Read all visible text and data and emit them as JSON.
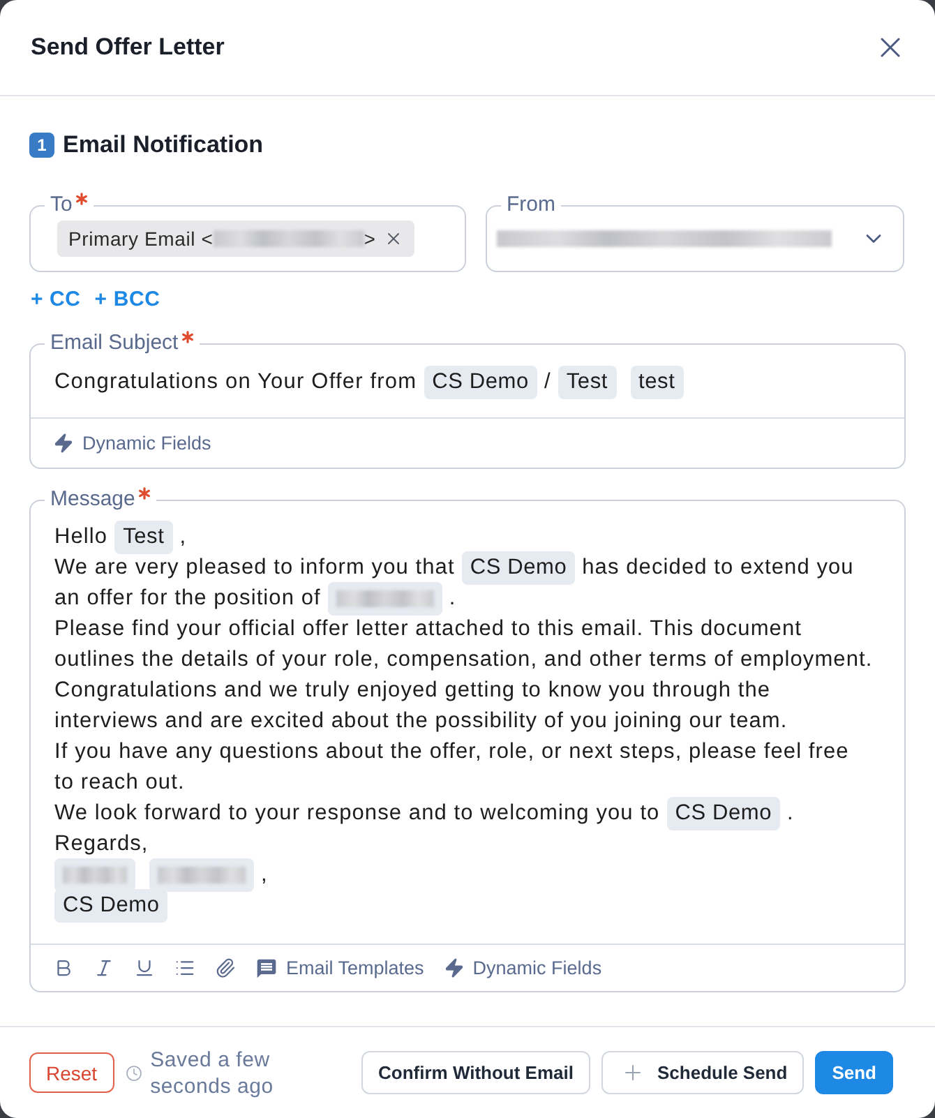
{
  "dialog": {
    "title": "Send Offer Letter"
  },
  "section": {
    "number": "1",
    "title": "Email Notification"
  },
  "to_field": {
    "label": "To",
    "required": true,
    "chips": [
      {
        "segments": [
          {
            "kind": "text",
            "text": "Primary Email <"
          },
          {
            "kind": "redacted"
          },
          {
            "kind": "text",
            "text": ">"
          }
        ],
        "removable": true
      }
    ]
  },
  "from_field": {
    "label": "From",
    "segments": [
      {
        "kind": "redacted"
      }
    ]
  },
  "recipient_links": [
    "+ CC",
    "+ BCC"
  ],
  "subject_field": {
    "label": "Email Subject",
    "required": true,
    "segments": [
      {
        "kind": "text",
        "text": "Congratulations on Your Offer from"
      },
      {
        "kind": "tag",
        "text": "CS Demo"
      },
      {
        "kind": "text",
        "text": "/"
      },
      {
        "kind": "tag",
        "text": "Test"
      },
      {
        "kind": "tag",
        "text": "test"
      }
    ],
    "toolbar": [
      {
        "kind": "dynamic",
        "label": "Dynamic Fields"
      }
    ]
  },
  "message_field": {
    "label": "Message",
    "required": true,
    "lines": [
      {
        "segments": [
          {
            "kind": "text",
            "text": "Hello"
          },
          {
            "kind": "tag",
            "text": "Test"
          },
          {
            "kind": "text",
            "text": ","
          }
        ]
      },
      {
        "segments": [
          {
            "kind": "text",
            "text": "We are very pleased to inform you that"
          },
          {
            "kind": "tag",
            "text": "CS Demo"
          },
          {
            "kind": "text",
            "text": "has decided to extend you"
          }
        ]
      },
      {
        "segments": [
          {
            "kind": "text",
            "text": "an offer for the position of"
          },
          {
            "kind": "redacted_tag"
          },
          {
            "kind": "text",
            "text": "."
          }
        ]
      },
      {
        "segments": [
          {
            "kind": "text",
            "text": "Please find your official offer letter attached to this email. This document"
          }
        ]
      },
      {
        "segments": [
          {
            "kind": "text",
            "text": "outlines the details of your role, compensation, and other terms of employment."
          }
        ]
      },
      {
        "segments": [
          {
            "kind": "text",
            "text": "Congratulations and we truly enjoyed getting to know you through the"
          }
        ]
      },
      {
        "segments": [
          {
            "kind": "text",
            "text": "interviews and are excited about the possibility of you joining our team."
          }
        ]
      },
      {
        "segments": [
          {
            "kind": "text",
            "text": "If you have any questions about the offer, role, or next steps, please feel free"
          }
        ]
      },
      {
        "segments": [
          {
            "kind": "text",
            "text": "to reach out."
          }
        ]
      },
      {
        "segments": [
          {
            "kind": "text",
            "text": "We look forward to your response and to welcoming you to"
          },
          {
            "kind": "tag",
            "text": "CS Demo"
          },
          {
            "kind": "text",
            "text": "."
          }
        ]
      },
      {
        "segments": [
          {
            "kind": "text",
            "text": "Regards,"
          }
        ]
      },
      {
        "segments": [
          {
            "kind": "redacted_tag"
          },
          {
            "kind": "redacted_tag"
          },
          {
            "kind": "text",
            "text": ","
          }
        ]
      },
      {
        "segments": [
          {
            "kind": "tag",
            "text": "CS Demo"
          }
        ]
      }
    ],
    "toolbar": [
      {
        "kind": "bold"
      },
      {
        "kind": "italic"
      },
      {
        "kind": "underline"
      },
      {
        "kind": "list"
      },
      {
        "kind": "attach"
      },
      {
        "kind": "templates",
        "label": "Email Templates"
      },
      {
        "kind": "dynamic",
        "label": "Dynamic Fields"
      }
    ]
  },
  "footer": {
    "reset": "Reset",
    "saved_status": "Saved a few seconds ago",
    "buttons": [
      {
        "kind": "outline",
        "label": "Confirm Without Email"
      },
      {
        "kind": "schedule",
        "label": "Schedule Send"
      },
      {
        "kind": "primary",
        "label": "Send"
      }
    ]
  }
}
